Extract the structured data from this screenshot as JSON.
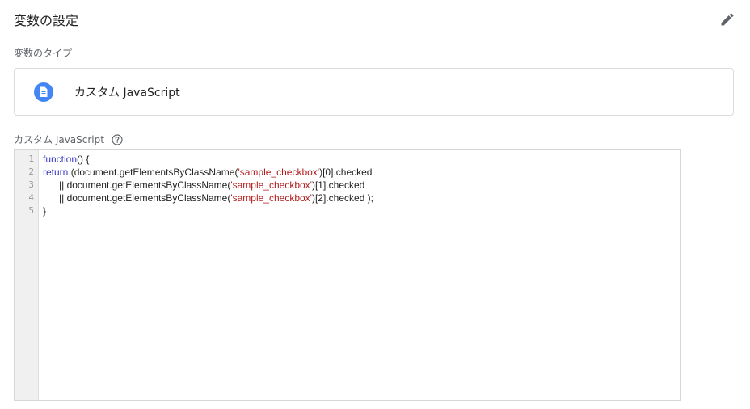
{
  "header": {
    "title": "変数の設定",
    "edit_icon": "pencil-icon"
  },
  "variable_type": {
    "label": "変数のタイプ",
    "name": "カスタム JavaScript",
    "icon": "document-icon",
    "icon_color": "#4285f4"
  },
  "editor": {
    "label": "カスタム JavaScript",
    "help_icon": "help-icon",
    "line_numbers": [
      "1",
      "2",
      "3",
      "4",
      "5"
    ],
    "lines": [
      [
        {
          "t": "function",
          "c": "kw"
        },
        {
          "t": "() {",
          "c": ""
        }
      ],
      [
        {
          "t": "return",
          "c": "kw"
        },
        {
          "t": " (document.getElementsByClassName(",
          "c": ""
        },
        {
          "t": "'sample_checkbox'",
          "c": "str"
        },
        {
          "t": ")[0].checked",
          "c": ""
        }
      ],
      [
        {
          "t": "      || document.getElementsByClassName(",
          "c": ""
        },
        {
          "t": "'sample_checkbox'",
          "c": "str"
        },
        {
          "t": ")[1].checked",
          "c": ""
        }
      ],
      [
        {
          "t": "      || document.getElementsByClassName(",
          "c": ""
        },
        {
          "t": "'sample_checkbox'",
          "c": "str"
        },
        {
          "t": ")[2].checked );",
          "c": ""
        }
      ],
      [
        {
          "t": "}",
          "c": ""
        }
      ]
    ]
  }
}
